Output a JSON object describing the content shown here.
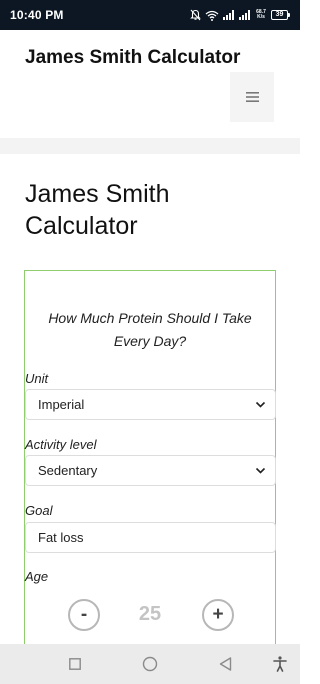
{
  "status_bar": {
    "time": "10:40 PM",
    "net_speed_value": "68.7",
    "net_speed_unit": "K/s",
    "battery": "39"
  },
  "header": {
    "site_title": "James Smith Calculator",
    "menu_icon": "hamburger-icon"
  },
  "page": {
    "title": "James Smith Calculator"
  },
  "calculator": {
    "question": "How Much Protein Should I Take Every Day?",
    "unit_label": "Unit",
    "unit_value": "Imperial",
    "activity_label": "Activity level",
    "activity_value": "Sedentary",
    "goal_label": "Goal",
    "goal_value": "Fat loss",
    "age_label": "Age",
    "age_minus": "-",
    "age_value": "25",
    "age_plus": "+"
  },
  "colors": {
    "status_bar_bg": "#0c1723",
    "card_border": "#8fce6c",
    "nav_bar_bg": "#ebebeb"
  }
}
